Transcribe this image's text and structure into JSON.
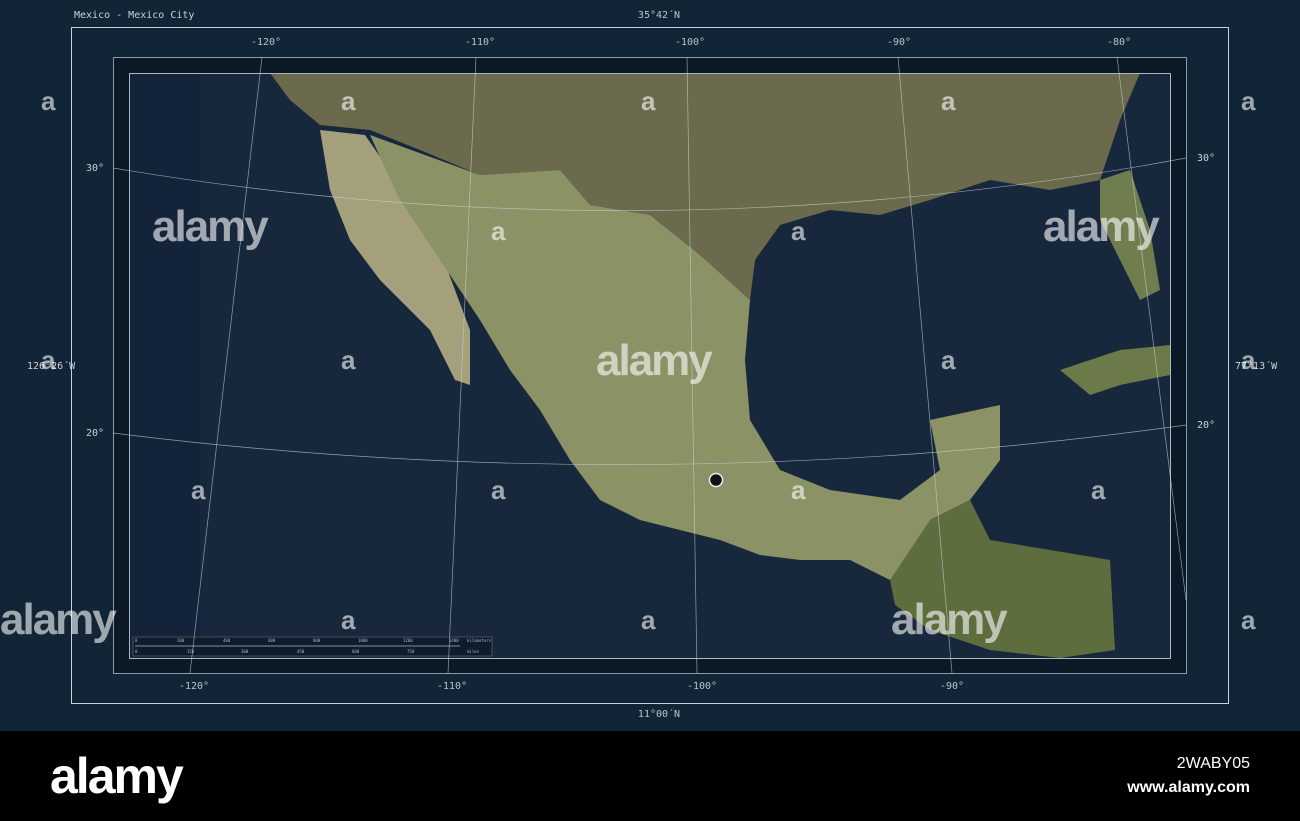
{
  "title": "Mexico - Mexico City",
  "bounds": {
    "north": "35°42´N",
    "south": "11°00´N",
    "west": "126°26´W",
    "east": "77°13´W"
  },
  "longitude_ticks_top": [
    "-120°",
    "-110°",
    "-100°",
    "-90°",
    "-80°"
  ],
  "longitude_ticks_bottom": [
    "-120°",
    "-110°",
    "-100°",
    "-90°"
  ],
  "latitude_ticks_left": [
    "30°",
    "20°"
  ],
  "latitude_ticks_right": [
    "30°",
    "20°"
  ],
  "scale_bar": {
    "km_ticks": [
      "0",
      "200",
      "400",
      "600",
      "800",
      "1000",
      "1200",
      "1400"
    ],
    "km_unit": "kilometers",
    "mi_ticks": [
      "0",
      "150",
      "300",
      "450",
      "600",
      "750"
    ],
    "mi_unit": "miles"
  },
  "marker": {
    "name": "Mexico City",
    "lon": -99.13,
    "lat": 19.43
  },
  "colors": {
    "ocean": "#14263a",
    "deep_ocean": "#0e1c2c",
    "land": "#7d8a5a",
    "desert": "#a9a27f",
    "frame": "#c8d2da",
    "background": "#112536"
  },
  "watermark": {
    "text": "alamy",
    "short": "a"
  },
  "banner": {
    "logo": "alamy",
    "image_id": "2WABY05",
    "url": "www.alamy.com"
  }
}
